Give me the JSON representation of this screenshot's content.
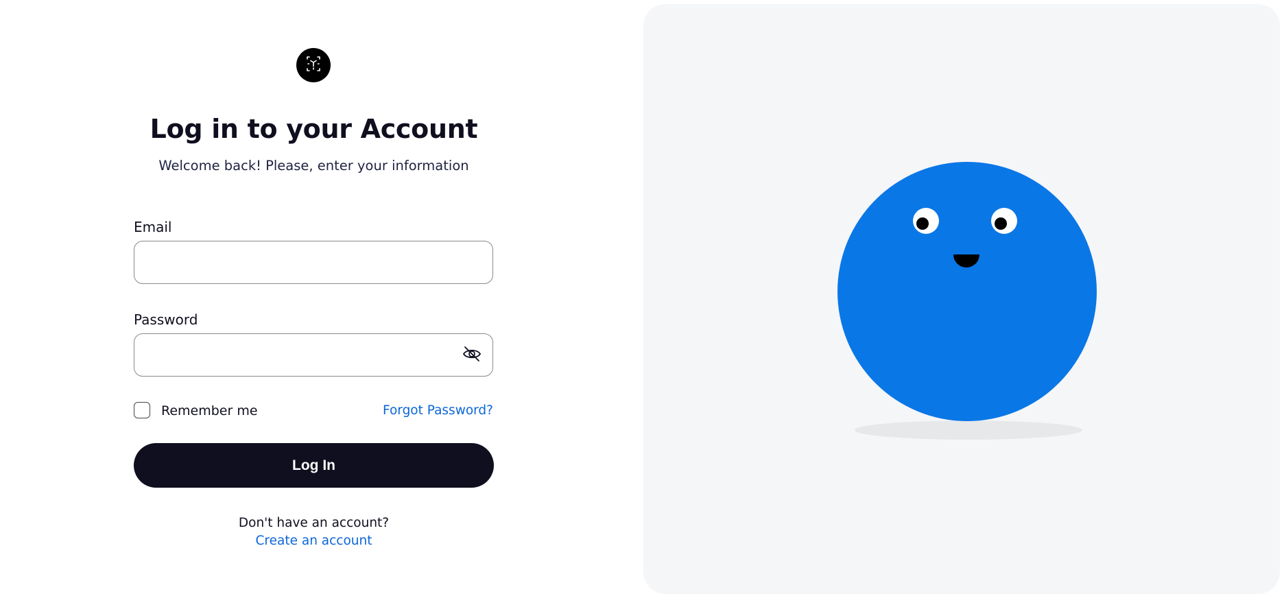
{
  "brand": {
    "logo_icon": "scan-cube-icon"
  },
  "header": {
    "title": "Log in to your Account",
    "subtitle": "Welcome back! Please, enter your information"
  },
  "form": {
    "email": {
      "label": "Email",
      "value": "",
      "placeholder": ""
    },
    "password": {
      "label": "Password",
      "value": "",
      "placeholder": "",
      "toggle_icon": "eye-off-icon"
    },
    "remember_me": {
      "label": "Remember me",
      "checked": false
    },
    "forgot_password_label": "Forgot Password?",
    "submit_label": "Log In"
  },
  "footer": {
    "prompt": "Don't have an account?",
    "create_account_label": "Create an account"
  },
  "illustration": {
    "character": "blue-ball-mascot",
    "body_color": "#0a77e6",
    "shadow_color": "#e6e8ea",
    "panel_color": "#f5f6f8"
  },
  "colors": {
    "primary_dark": "#0f0f1f",
    "link": "#0a66d8"
  }
}
